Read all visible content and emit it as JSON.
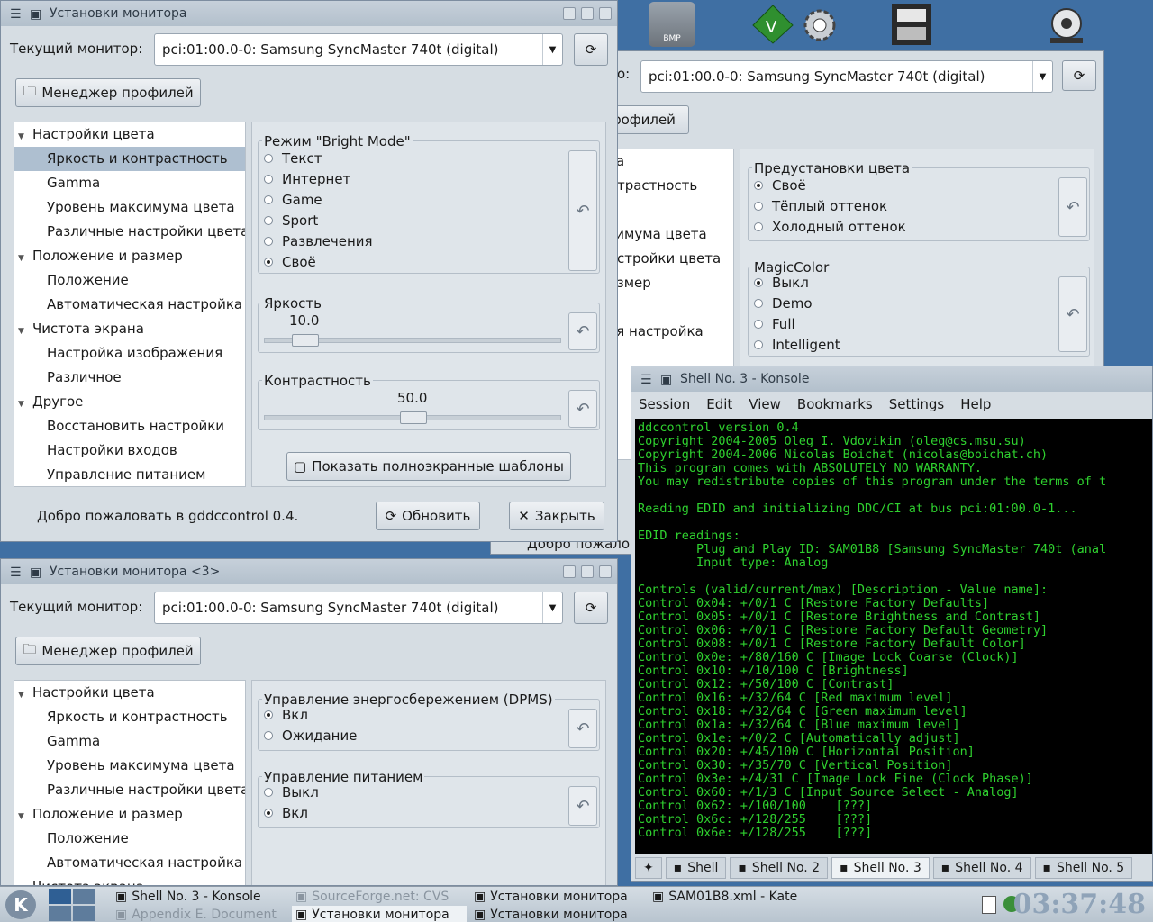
{
  "desktop": {
    "icons": [
      "bmp-icon",
      "vim-icon",
      "settings-icon",
      "film-icon",
      "speaker-icon"
    ],
    "bmp_label": "BMP"
  },
  "win1": {
    "title": "Установки монитора",
    "monitor_label": "Текущий монитор:",
    "monitor_value": "pci:01:00.0-0: Samsung SyncMaster 740t (digital)",
    "profile_manager": "Менеджер профилей",
    "tree": [
      {
        "label": "Настройки цвета",
        "level": 0
      },
      {
        "label": "Яркость и контрастность",
        "level": 1,
        "selected": true
      },
      {
        "label": "Gamma",
        "level": 1
      },
      {
        "label": "Уровень максимума цвета",
        "level": 1
      },
      {
        "label": "Различные настройки цвета",
        "level": 1
      },
      {
        "label": "Положение и размер",
        "level": 0
      },
      {
        "label": "Положение",
        "level": 1
      },
      {
        "label": "Автоматическая настройка",
        "level": 1
      },
      {
        "label": "Чистота экрана",
        "level": 0
      },
      {
        "label": "Настройка изображения",
        "level": 1
      },
      {
        "label": "Различное",
        "level": 1
      },
      {
        "label": "Другое",
        "level": 0
      },
      {
        "label": "Восстановить настройки",
        "level": 1
      },
      {
        "label": "Настройки входов",
        "level": 1
      },
      {
        "label": "Управление питанием",
        "level": 1
      }
    ],
    "bright_mode": {
      "title": "Режим \"Bright Mode\"",
      "options": [
        "Текст",
        "Интернет",
        "Game",
        "Sport",
        "Развлечения",
        "Своё"
      ],
      "selected": 5
    },
    "brightness": {
      "title": "Яркость",
      "value": "10.0",
      "fraction": 0.1
    },
    "contrast": {
      "title": "Контрастность",
      "value": "50.0",
      "fraction": 0.5
    },
    "show_patterns": "Показать полноэкранные шаблоны",
    "status": "Добро пожаловать в gddccontrol 0.4.",
    "refresh": "Обновить",
    "close": "Закрыть"
  },
  "win2": {
    "monitor_label_tail": "o:",
    "monitor_value": "pci:01:00.0-0: Samsung SyncMaster 740t (digital)",
    "profile_tail": "рофилей",
    "tree_tails": [
      "ета",
      "онтрастность",
      "",
      "ксимума цвета",
      "настройки цвета",
      "размер",
      "",
      "кая настройка",
      "а"
    ],
    "presets": {
      "title": "Предустановки цвета",
      "options": [
        "Своё",
        "Тёплый оттенок",
        "Холодный оттенок"
      ],
      "selected": 0
    },
    "magiccolor": {
      "title": "MagicColor",
      "options": [
        "Выкл",
        "Demo",
        "Full",
        "Intelligent"
      ],
      "selected": 0
    },
    "status_tail": "Добро пожалов"
  },
  "win3": {
    "title": "Установки монитора <3>",
    "monitor_label": "Текущий монитор:",
    "monitor_value": "pci:01:00.0-0: Samsung SyncMaster 740t (digital)",
    "profile_manager": "Менеджер профилей",
    "tree": [
      {
        "label": "Настройки цвета",
        "level": 0
      },
      {
        "label": "Яркость и контрастность",
        "level": 1
      },
      {
        "label": "Gamma",
        "level": 1
      },
      {
        "label": "Уровень максимума цвета",
        "level": 1
      },
      {
        "label": "Различные настройки цвета",
        "level": 1
      },
      {
        "label": "Положение и размер",
        "level": 0
      },
      {
        "label": "Положение",
        "level": 1
      },
      {
        "label": "Автоматическая настройка",
        "level": 1
      },
      {
        "label": "Чистота экрана",
        "level": 0
      }
    ],
    "dpms": {
      "title": "Управление энергосбережением (DPMS)",
      "options": [
        "Вкл",
        "Ожидание"
      ],
      "selected": 0
    },
    "power": {
      "title": "Управление питанием",
      "options": [
        "Выкл",
        "Вкл"
      ],
      "selected": 1
    }
  },
  "konsole": {
    "title": "Shell No. 3 - Konsole",
    "menu": [
      "Session",
      "Edit",
      "View",
      "Bookmarks",
      "Settings",
      "Help"
    ],
    "lines": [
      "ddccontrol version 0.4",
      "Copyright 2004-2005 Oleg I. Vdovikin (oleg@cs.msu.su)",
      "Copyright 2004-2006 Nicolas Boichat (nicolas@boichat.ch)",
      "This program comes with ABSOLUTELY NO WARRANTY.",
      "You may redistribute copies of this program under the terms of t",
      "",
      "Reading EDID and initializing DDC/CI at bus pci:01:00.0-1...",
      "",
      "EDID readings:",
      "        Plug and Play ID: SAM01B8 [Samsung SyncMaster 740t (anal",
      "        Input type: Analog",
      "",
      "Controls (valid/current/max) [Description - Value name]:",
      "Control 0x04: +/0/1 C [Restore Factory Defaults]",
      "Control 0x05: +/0/1 C [Restore Brightness and Contrast]",
      "Control 0x06: +/0/1 C [Restore Factory Default Geometry]",
      "Control 0x08: +/0/1 C [Restore Factory Default Color]",
      "Control 0x0e: +/80/160 C [Image Lock Coarse (Clock)]",
      "Control 0x10: +/10/100 C [Brightness]",
      "Control 0x12: +/50/100 C [Contrast]",
      "Control 0x16: +/32/64 C [Red maximum level]",
      "Control 0x18: +/32/64 C [Green maximum level]",
      "Control 0x1a: +/32/64 C [Blue maximum level]",
      "Control 0x1e: +/0/2 C [Automatically adjust]",
      "Control 0x20: +/45/100 C [Horizontal Position]",
      "Control 0x30: +/35/70 C [Vertical Position]",
      "Control 0x3e: +/4/31 C [Image Lock Fine (Clock Phase)]",
      "Control 0x60: +/1/3 C [Input Source Select - Analog]",
      "Control 0x62: +/100/100    [???]",
      "Control 0x6c: +/128/255    [???]",
      "Control 0x6e: +/128/255    [???]"
    ],
    "tabs": [
      "Shell",
      "Shell No. 2",
      "Shell No. 3",
      "Shell No. 4",
      "Shell No. 5"
    ],
    "active_tab": 2
  },
  "taskbar": {
    "items": [
      {
        "label": "Shell No. 3 - Konsole",
        "state": "normal"
      },
      {
        "label": "SourceForge.net: CVS",
        "state": "dim"
      },
      {
        "label": "Установки монитора",
        "state": "normal"
      },
      {
        "label": "SAM01B8.xml - Kate",
        "state": "normal"
      },
      {
        "label": "Appendix E. Document",
        "state": "dim"
      },
      {
        "label": "Установки монитора",
        "state": "active"
      },
      {
        "label": "Установки монитора",
        "state": "normal"
      }
    ],
    "clock": "03:37:48"
  }
}
